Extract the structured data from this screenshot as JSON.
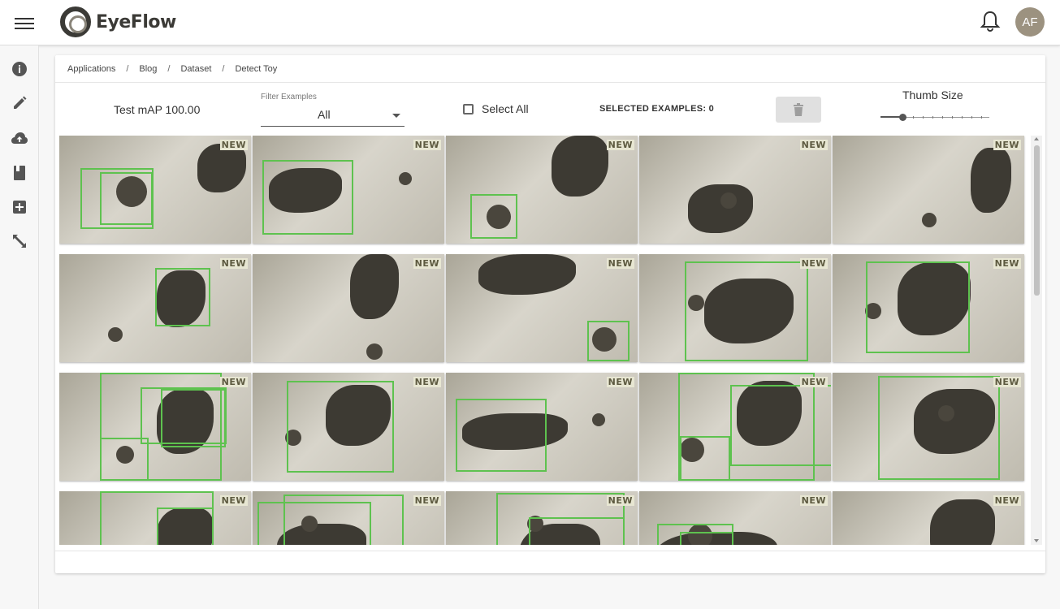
{
  "header": {
    "app_name": "EyeFlow",
    "avatar_initials": "AF",
    "accent_color": "#5ec24f"
  },
  "rail": {
    "items": [
      {
        "icon": "info-icon"
      },
      {
        "icon": "pencil-icon"
      },
      {
        "icon": "cloud-upload-icon"
      },
      {
        "icon": "book-icon"
      },
      {
        "icon": "add-box-icon"
      },
      {
        "icon": "resize-icon"
      }
    ]
  },
  "breadcrumb": {
    "items": [
      "Applications",
      "Blog",
      "Dataset",
      "Detect Toy"
    ],
    "separator": "/"
  },
  "toolbar": {
    "map_text": "Test mAP 100.00",
    "filter_label": "Filter Examples",
    "filter_value": "All",
    "select_all_label": "Select All",
    "select_all_checked": false,
    "selected_count_label": "SELECTED EXAMPLES: 0",
    "thumb_size_label": "Thumb Size"
  },
  "examples": {
    "badge_label": "NEW",
    "count_visible": 20,
    "rows": 4,
    "columns": 5
  }
}
